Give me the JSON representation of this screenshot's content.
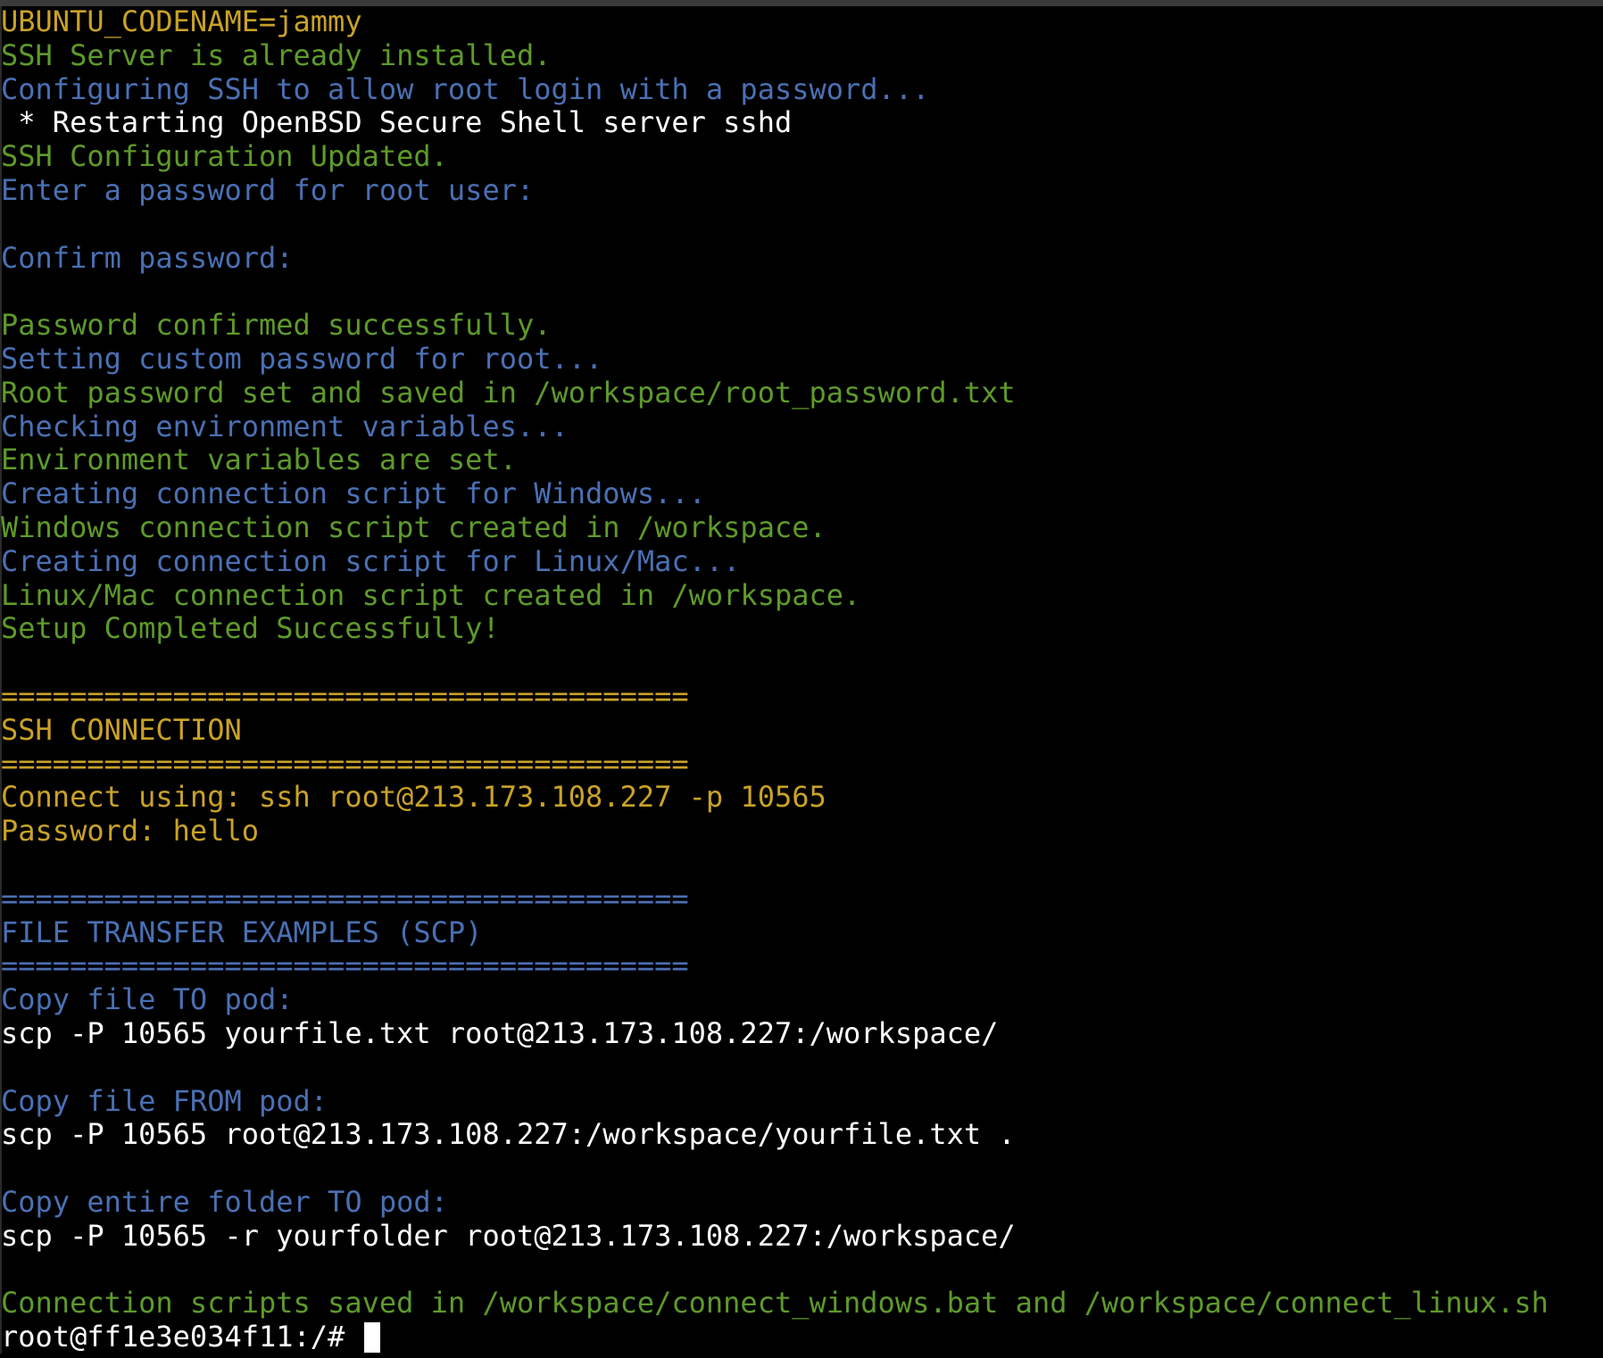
{
  "colors": {
    "yellow": "#c9a227",
    "green": "#5e9a2a",
    "blue": "#4a70b4",
    "white": "#ffffff",
    "background": "#000000"
  },
  "terminal": {
    "lines": [
      {
        "text": "UBUNTU_CODENAME=jammy",
        "color": "yellow"
      },
      {
        "text": "SSH Server is already installed.",
        "color": "green"
      },
      {
        "text": "Configuring SSH to allow root login with a password...",
        "color": "blue"
      },
      {
        "text": " * Restarting OpenBSD Secure Shell server sshd",
        "color": "white"
      },
      {
        "text": "SSH Configuration Updated.",
        "color": "green"
      },
      {
        "text": "Enter a password for root user:",
        "color": "blue"
      },
      {
        "text": "",
        "color": "white"
      },
      {
        "text": "Confirm password:",
        "color": "blue"
      },
      {
        "text": "",
        "color": "white"
      },
      {
        "text": "Password confirmed successfully.",
        "color": "green"
      },
      {
        "text": "Setting custom password for root...",
        "color": "blue"
      },
      {
        "text": "Root password set and saved in /workspace/root_password.txt",
        "color": "green"
      },
      {
        "text": "Checking environment variables...",
        "color": "blue"
      },
      {
        "text": "Environment variables are set.",
        "color": "green"
      },
      {
        "text": "Creating connection script for Windows...",
        "color": "blue"
      },
      {
        "text": "Windows connection script created in /workspace.",
        "color": "green"
      },
      {
        "text": "Creating connection script for Linux/Mac...",
        "color": "blue"
      },
      {
        "text": "Linux/Mac connection script created in /workspace.",
        "color": "green"
      },
      {
        "text": "Setup Completed Successfully!",
        "color": "green"
      },
      {
        "text": "",
        "color": "white"
      },
      {
        "text": "========================================",
        "color": "yellow"
      },
      {
        "text": "SSH CONNECTION",
        "color": "yellow"
      },
      {
        "text": "========================================",
        "color": "yellow"
      },
      {
        "text": "Connect using: ssh root@213.173.108.227 -p 10565",
        "color": "yellow"
      },
      {
        "text": "Password: hello",
        "color": "yellow"
      },
      {
        "text": "",
        "color": "white"
      },
      {
        "text": "========================================",
        "color": "blue"
      },
      {
        "text": "FILE TRANSFER EXAMPLES (SCP)",
        "color": "blue"
      },
      {
        "text": "========================================",
        "color": "blue"
      },
      {
        "text": "Copy file TO pod:",
        "color": "blue"
      },
      {
        "text": "scp -P 10565 yourfile.txt root@213.173.108.227:/workspace/",
        "color": "white"
      },
      {
        "text": "",
        "color": "white"
      },
      {
        "text": "Copy file FROM pod:",
        "color": "blue"
      },
      {
        "text": "scp -P 10565 root@213.173.108.227:/workspace/yourfile.txt .",
        "color": "white"
      },
      {
        "text": "",
        "color": "white"
      },
      {
        "text": "Copy entire folder TO pod:",
        "color": "blue"
      },
      {
        "text": "scp -P 10565 -r yourfolder root@213.173.108.227:/workspace/",
        "color": "white"
      },
      {
        "text": "",
        "color": "white"
      },
      {
        "text": "Connection scripts saved in /workspace/connect_windows.bat and /workspace/connect_linux.sh",
        "color": "green"
      }
    ],
    "prompt": "root@ff1e3e034f11:/# "
  }
}
